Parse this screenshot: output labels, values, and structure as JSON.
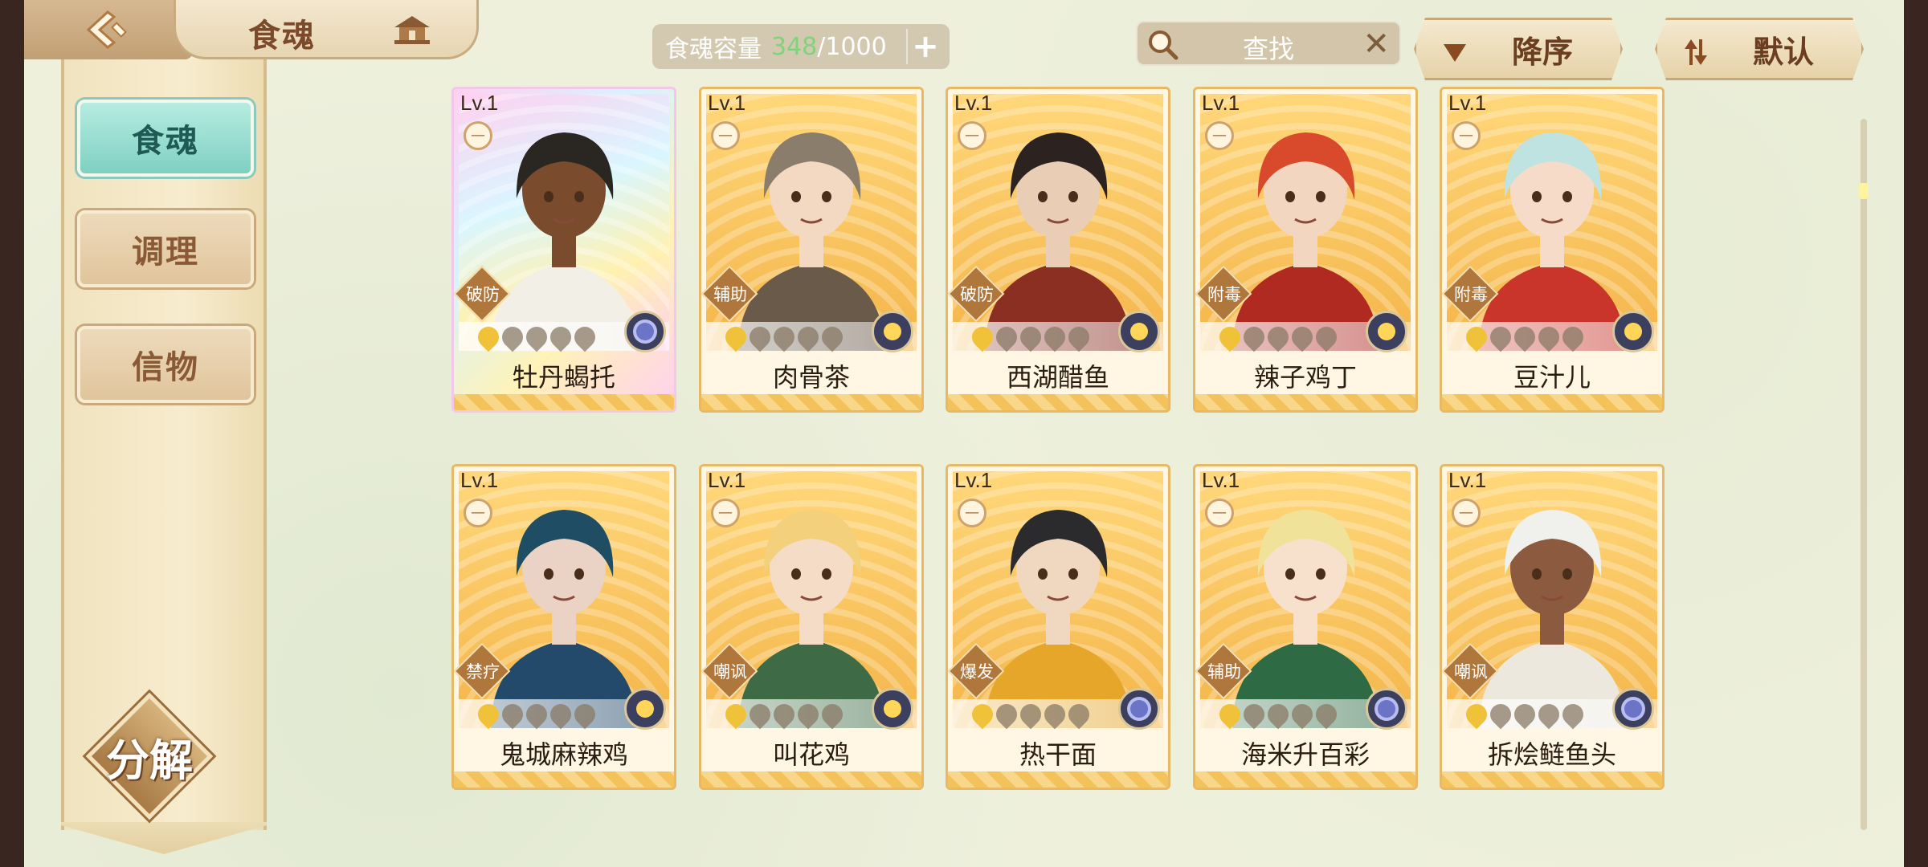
{
  "header": {
    "title": "食魂",
    "capacity": {
      "label": "食魂容量",
      "current": "348",
      "separator": "/",
      "max": "1000"
    },
    "search_text": "查找",
    "sort_desc_label": "降序",
    "sort_default_label": "默认"
  },
  "sidebar": {
    "tabs": [
      {
        "label": "食魂",
        "active": true
      },
      {
        "label": "调理",
        "active": false
      },
      {
        "label": "信物",
        "active": false
      }
    ],
    "decompose_label": "分解"
  },
  "cards": [
    {
      "level": "Lv.1",
      "role": "破防",
      "name": "牡丹蝎托",
      "lit_stars": 1,
      "element": "flower",
      "rarity": "rainbow",
      "hair": "#2a2622",
      "skin": "#7a4b2c",
      "outfit": "#f2efe6"
    },
    {
      "level": "Lv.1",
      "role": "辅助",
      "name": "肉骨茶",
      "lit_stars": 1,
      "element": "bell",
      "rarity": "gold",
      "hair": "#8b7d6c",
      "skin": "#f3d9c2",
      "outfit": "#6a5a4a"
    },
    {
      "level": "Lv.1",
      "role": "破防",
      "name": "西湖醋鱼",
      "lit_stars": 1,
      "element": "bell",
      "rarity": "gold",
      "hair": "#2c2320",
      "skin": "#e9cdb4",
      "outfit": "#8a2f22"
    },
    {
      "level": "Lv.1",
      "role": "附毒",
      "name": "辣子鸡丁",
      "lit_stars": 1,
      "element": "bell",
      "rarity": "gold",
      "hair": "#d94a2c",
      "skin": "#f3d6c0",
      "outfit": "#b02a22"
    },
    {
      "level": "Lv.1",
      "role": "附毒",
      "name": "豆汁儿",
      "lit_stars": 1,
      "element": "bell",
      "rarity": "gold",
      "hair": "#bfe3e0",
      "skin": "#f6dcc8",
      "outfit": "#c9352a"
    },
    {
      "level": "Lv.1",
      "role": "禁疗",
      "name": "鬼城麻辣鸡",
      "lit_stars": 1,
      "element": "bell",
      "rarity": "gold",
      "hair": "#1f4d63",
      "skin": "#ead2c4",
      "outfit": "#234a6a"
    },
    {
      "level": "Lv.1",
      "role": "嘲讽",
      "name": "叫花鸡",
      "lit_stars": 1,
      "element": "bell",
      "rarity": "gold",
      "hair": "#f2d07c",
      "skin": "#f4dcc6",
      "outfit": "#3e6b45"
    },
    {
      "level": "Lv.1",
      "role": "爆发",
      "name": "热干面",
      "lit_stars": 1,
      "element": "flower",
      "rarity": "gold",
      "hair": "#2b2a2c",
      "skin": "#f0d7c0",
      "outfit": "#e5a62a"
    },
    {
      "level": "Lv.1",
      "role": "辅助",
      "name": "海米升百彩",
      "lit_stars": 1,
      "element": "flower",
      "rarity": "gold",
      "hair": "#f1e29a",
      "skin": "#f7e0cc",
      "outfit": "#2e6b45"
    },
    {
      "level": "Lv.1",
      "role": "嘲讽",
      "name": "拆烩鲢鱼头",
      "lit_stars": 1,
      "element": "flower",
      "rarity": "gold",
      "hair": "#f0f0ec",
      "skin": "#8c5a3e",
      "outfit": "#ece8de"
    }
  ]
}
